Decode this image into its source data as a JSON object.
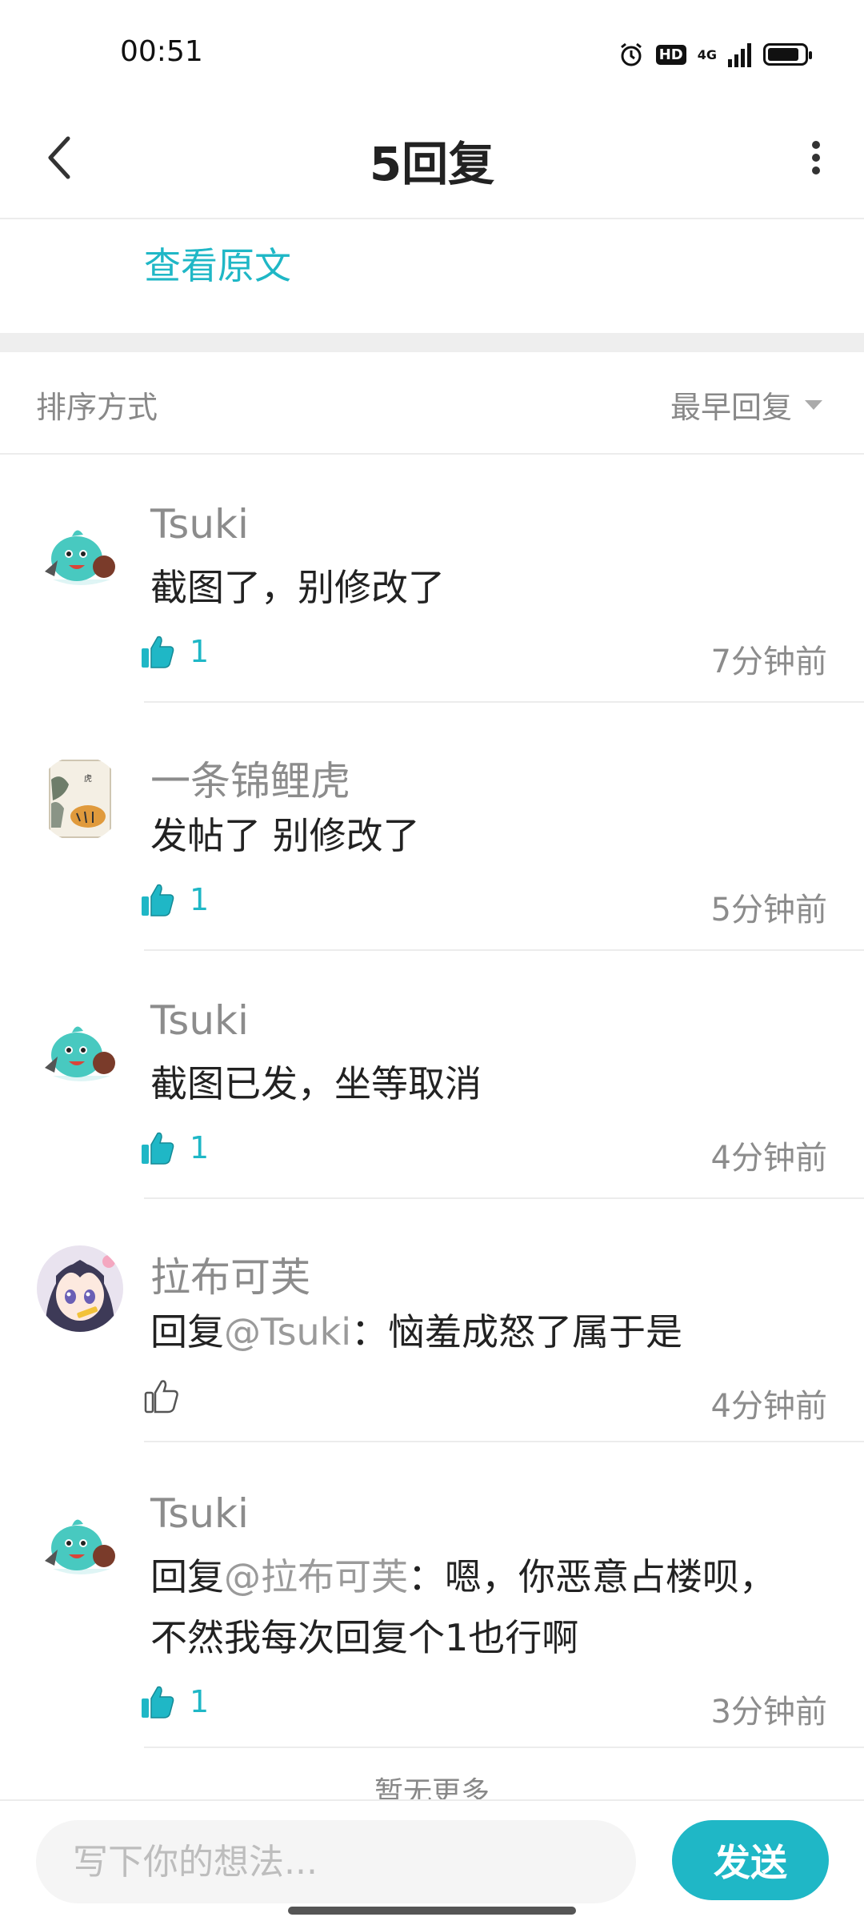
{
  "status_bar": {
    "time": "00:51",
    "hd": "HD",
    "network": "4G"
  },
  "nav": {
    "title": "5回复"
  },
  "view_original": "查看原文",
  "sort": {
    "label": "排序方式",
    "value": "最早回复"
  },
  "comments": [
    {
      "name": "Tsuki",
      "text": "截图了，别修改了",
      "likes": "1",
      "liked": true,
      "time": "7分钟前",
      "avatar": "slime-avatar"
    },
    {
      "name": "一条锦鲤虎",
      "text": "发帖了 别修改了",
      "likes": "1",
      "liked": true,
      "time": "5分钟前",
      "avatar": "tiger-painting-avatar"
    },
    {
      "name": "Tsuki",
      "text": "截图已发，坐等取消",
      "likes": "1",
      "liked": true,
      "time": "4分钟前",
      "avatar": "slime-avatar"
    },
    {
      "name": "拉布可芙",
      "reply_prefix": "回复",
      "mention": "@Tsuki",
      "text": "：恼羞成怒了属于是",
      "liked": false,
      "time": "4分钟前",
      "avatar": "anime-girl-avatar"
    },
    {
      "name": "Tsuki",
      "reply_prefix": "回复",
      "mention": "@拉布可芙",
      "text": "：嗯，你恶意占楼呗，不然我每次回复个1也行啊",
      "likes": "1",
      "liked": true,
      "time": "3分钟前",
      "avatar": "slime-avatar"
    }
  ],
  "load_more": "暂无更多",
  "input": {
    "placeholder": "写下你的想法...",
    "send_label": "发送"
  },
  "colors": {
    "accent": "#1fb7c6"
  }
}
